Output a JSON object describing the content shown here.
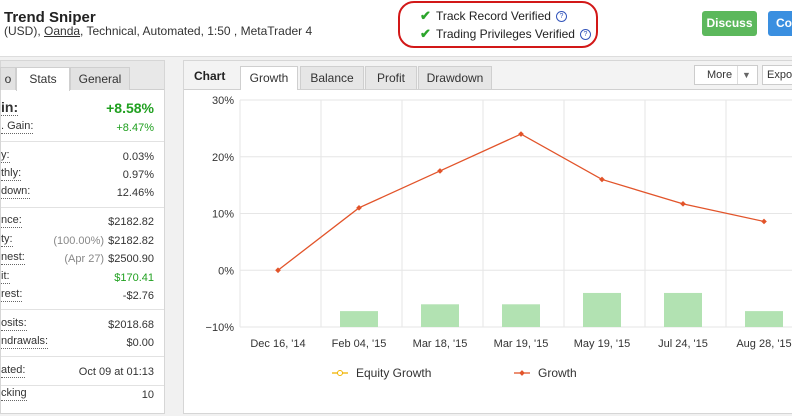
{
  "header": {
    "title": "Trend Sniper",
    "subtitle_pre": "(USD),",
    "broker": "Oanda",
    "subtitle_post": ", Technical, Automated, 1:50 , MetaTrader 4",
    "track_record": "Track Record Verified",
    "trading_privileges": "Trading Privileges Verified",
    "discuss_label": "Discuss",
    "copy_label": "Co"
  },
  "left_tabs": {
    "info": "o",
    "stats": "Stats",
    "general": "General"
  },
  "stats": {
    "gain_label": "in:",
    "gain_value": "+8.58%",
    "abs_gain_label": ". Gain:",
    "abs_gain_value": "+8.47%",
    "daily_label": "y:",
    "daily_value": "0.03%",
    "monthly_label": "thly:",
    "monthly_value": "0.97%",
    "drawdown_label": "down:",
    "drawdown_value": "12.46%",
    "balance_label": "nce:",
    "balance_value": "$2182.82",
    "equity_label": "ty:",
    "equity_pct": "(100.00%)",
    "equity_value": "$2182.82",
    "highest_label": "nest:",
    "highest_date": "(Apr 27)",
    "highest_value": "$2500.90",
    "profit_label": "it:",
    "profit_value": "$170.41",
    "interest_label": "rest:",
    "interest_value": "-$2.76",
    "deposits_label": "osits:",
    "deposits_value": "$2018.68",
    "withdrawals_label": "ndrawals:",
    "withdrawals_value": "$0.00",
    "updated_label": "ated:",
    "updated_value": "Oct 09 at 01:13",
    "tracking_label": "cking",
    "tracking_value": "10"
  },
  "chart_panel": {
    "title": "Chart",
    "tabs": [
      "Growth",
      "Balance",
      "Profit",
      "Drawdown"
    ],
    "more_label": "More",
    "export_label": "Expo"
  },
  "chart_data": {
    "type": "line",
    "categories": [
      "Dec 16, '14",
      "Feb 04, '15",
      "Mar 18, '15",
      "Mar 19, '15",
      "May 19, '15",
      "Jul 24, '15",
      "Aug 28, '15"
    ],
    "ylim": [
      -10,
      30
    ],
    "yticks": [
      "30%",
      "20%",
      "10%",
      "0%",
      "−10%"
    ],
    "series": [
      {
        "name": "Equity Growth",
        "color": "#f0b400",
        "values": [
          null,
          null,
          null,
          null,
          null,
          null,
          null
        ]
      },
      {
        "name": "Growth",
        "color": "#e2542a",
        "values": [
          0,
          11,
          17.5,
          24,
          16,
          11.7,
          8.6
        ]
      }
    ],
    "bars": {
      "color": "#b2e2b2",
      "values": [
        null,
        -7.2,
        -6.0,
        -6.0,
        -4.0,
        -4.0,
        -7.2
      ]
    },
    "grid": true,
    "legend": "bottom"
  }
}
